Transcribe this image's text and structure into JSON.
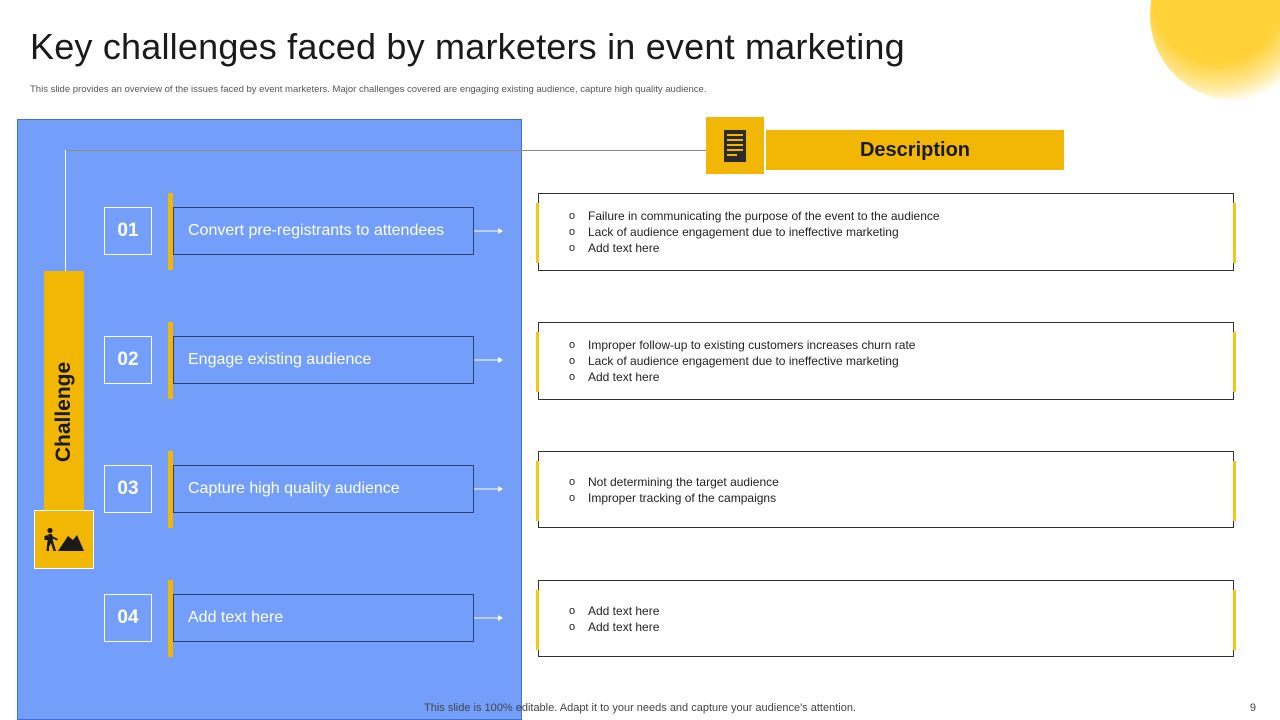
{
  "slide": {
    "title": "Key challenges faced by marketers in event marketing",
    "subtitle": "This slide provides an overview of the issues faced by event marketers. Major challenges covered are engaging existing audience, capture high quality audience.",
    "footer": "This slide is 100% editable. Adapt it to your needs and capture your audience's attention.",
    "page_number": "9"
  },
  "challenge_label": "Challenge",
  "description_header": "Description",
  "icons": {
    "challenge": "climber-mountain-icon",
    "description": "document-icon"
  },
  "colors": {
    "accent_yellow": "#f2b705",
    "panel_blue": "#739efa"
  },
  "challenges": [
    {
      "number": "01",
      "label": "Convert pre-registrants to attendees",
      "descriptions": [
        "Failure in communicating the purpose  of the event  to the audience",
        "Lack of audience  engagement  due to ineffective  marketing",
        "Add text here"
      ]
    },
    {
      "number": "02",
      "label": "Engage existing audience",
      "descriptions": [
        "Improper  follow-up  to existing customers increases churn rate",
        "Lack of audience  engagement  due to ineffective  marketing",
        "Add text here"
      ]
    },
    {
      "number": "03",
      "label": "Capture high quality audience",
      "descriptions": [
        "Not  determining the target audience",
        "Improper  tracking of the campaigns"
      ]
    },
    {
      "number": "04",
      "label": "Add text here",
      "descriptions": [
        "Add text here",
        "Add text here"
      ]
    }
  ]
}
